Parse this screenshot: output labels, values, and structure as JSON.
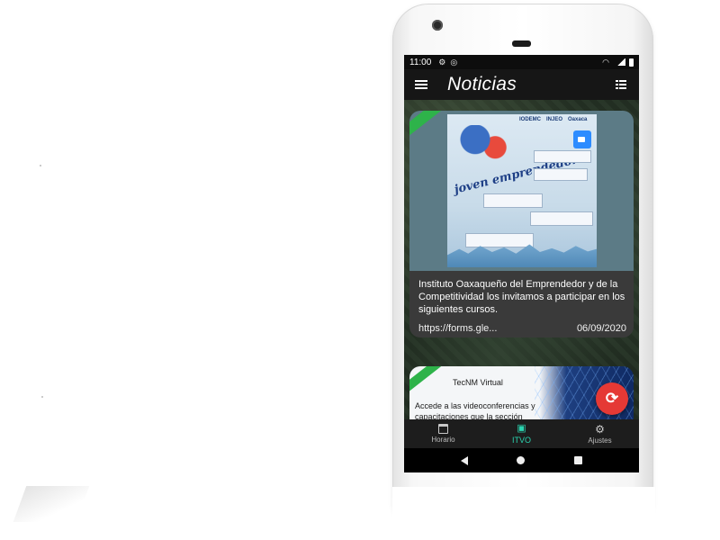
{
  "status_bar": {
    "time": "11:00",
    "icons": [
      "gear-icon",
      "sync-icon",
      "wifi-icon",
      "signal-icon",
      "battery-icon"
    ]
  },
  "app_bar": {
    "title": "Noticias",
    "menu_icon": "hamburger-icon",
    "view_icon": "list-view-icon"
  },
  "news": [
    {
      "poster": {
        "logos": [
          "IODEMC",
          "INJEO",
          "Oaxaca"
        ],
        "headline": "joven emprendedor",
        "zoom_label": "zoom"
      },
      "description": "Instituto Oaxaqueño del Emprendedor y de la Competitividad los invitamos a participar en los siguientes cursos.",
      "link": "https://forms.gle...",
      "date": "06/09/2020"
    },
    {
      "title": "TecNM Virtual",
      "description": "Accede a las videoconferencias y capacitaciones que la sección"
    }
  ],
  "fab": {
    "icon": "refresh-icon"
  },
  "bottom_nav": [
    {
      "label": "Horario",
      "icon": "calendar-icon",
      "active": false
    },
    {
      "label": "ITVO",
      "icon": "book-icon",
      "active": true
    },
    {
      "label": "Ajustes",
      "icon": "gear-icon",
      "active": false
    }
  ],
  "system_nav": [
    "back-icon",
    "home-icon",
    "recents-icon"
  ],
  "colors": {
    "accent": "#2bd4b0",
    "fab": "#e53935",
    "appbar": "#161616",
    "stripe": "#2eb34a"
  }
}
